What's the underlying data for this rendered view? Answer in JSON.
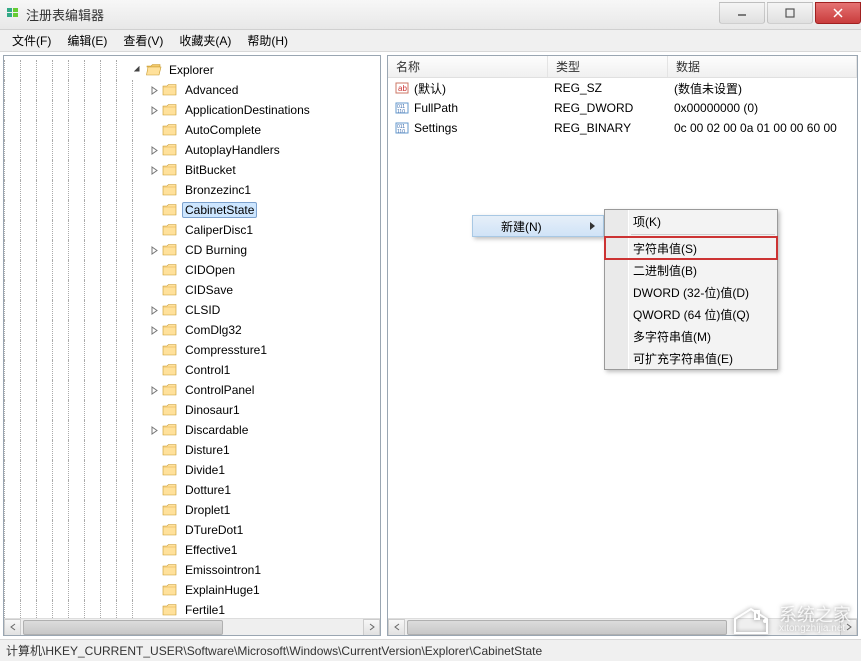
{
  "window": {
    "title": "注册表编辑器"
  },
  "menu": {
    "file": "文件(F)",
    "edit": "编辑(E)",
    "view": "查看(V)",
    "favorites": "收藏夹(A)",
    "help": "帮助(H)"
  },
  "tree": {
    "root_label": "Explorer",
    "root_icon": "folder-open",
    "selected": "CabinetState",
    "children": [
      {
        "label": "Advanced",
        "expandable": true
      },
      {
        "label": "ApplicationDestinations",
        "expandable": true
      },
      {
        "label": "AutoComplete",
        "expandable": false
      },
      {
        "label": "AutoplayHandlers",
        "expandable": true
      },
      {
        "label": "BitBucket",
        "expandable": true
      },
      {
        "label": "Bronzezinc1",
        "expandable": false
      },
      {
        "label": "CabinetState",
        "expandable": false
      },
      {
        "label": "CaliperDisc1",
        "expandable": false
      },
      {
        "label": "CD Burning",
        "expandable": true
      },
      {
        "label": "CIDOpen",
        "expandable": false
      },
      {
        "label": "CIDSave",
        "expandable": false
      },
      {
        "label": "CLSID",
        "expandable": true
      },
      {
        "label": "ComDlg32",
        "expandable": true
      },
      {
        "label": "Compressture1",
        "expandable": false
      },
      {
        "label": "Control1",
        "expandable": false
      },
      {
        "label": "ControlPanel",
        "expandable": true
      },
      {
        "label": "Dinosaur1",
        "expandable": false
      },
      {
        "label": "Discardable",
        "expandable": true
      },
      {
        "label": "Disture1",
        "expandable": false
      },
      {
        "label": "Divide1",
        "expandable": false
      },
      {
        "label": "Dotture1",
        "expandable": false
      },
      {
        "label": "Droplet1",
        "expandable": false
      },
      {
        "label": "DTureDot1",
        "expandable": false
      },
      {
        "label": "Effective1",
        "expandable": false
      },
      {
        "label": "Emissointron1",
        "expandable": false
      },
      {
        "label": "ExplainHuge1",
        "expandable": false
      },
      {
        "label": "Fertile1",
        "expandable": false
      }
    ]
  },
  "list": {
    "headers": {
      "name": "名称",
      "type": "类型",
      "data": "数据"
    },
    "rows": [
      {
        "icon": "string",
        "name": "(默认)",
        "type": "REG_SZ",
        "data": "(数值未设置)"
      },
      {
        "icon": "binary",
        "name": "FullPath",
        "type": "REG_DWORD",
        "data": "0x00000000 (0)"
      },
      {
        "icon": "binary",
        "name": "Settings",
        "type": "REG_BINARY",
        "data": "0c 00 02 00 0a 01 00 00 60 00"
      }
    ]
  },
  "context_menu": {
    "new_label": "新建(N)",
    "items": [
      {
        "label": "项(K)"
      },
      {
        "label": "字符串值(S)",
        "highlight": true
      },
      {
        "label": "二进制值(B)"
      },
      {
        "label": "DWORD (32-位)值(D)"
      },
      {
        "label": "QWORD (64 位)值(Q)"
      },
      {
        "label": "多字符串值(M)"
      },
      {
        "label": "可扩充字符串值(E)"
      }
    ]
  },
  "statusbar": {
    "path": "计算机\\HKEY_CURRENT_USER\\Software\\Microsoft\\Windows\\CurrentVersion\\Explorer\\CabinetState"
  },
  "watermark": {
    "title": "系统之家",
    "sub": "xitongzhijia.net"
  }
}
